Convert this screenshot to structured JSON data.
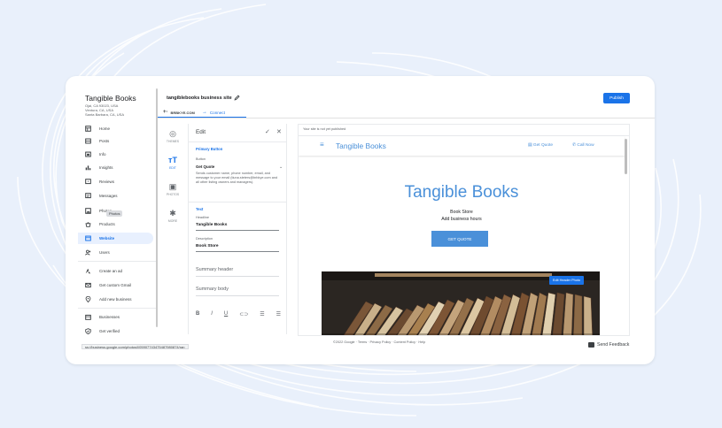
{
  "sidebar": {
    "business_name": "Tangible Books",
    "address_lines": [
      "Ojai, CA 93023, USA",
      "Ventura, CA, USA",
      "Santa Barbara, CA, USA"
    ],
    "items": [
      {
        "label": "Home",
        "icon": "home-icon"
      },
      {
        "label": "Posts",
        "icon": "posts-icon"
      },
      {
        "label": "Info",
        "icon": "info-icon"
      },
      {
        "label": "Insights",
        "icon": "insights-icon"
      },
      {
        "label": "Reviews",
        "icon": "reviews-icon"
      },
      {
        "label": "Messages",
        "icon": "messages-icon"
      },
      {
        "label": "Photos",
        "icon": "photos-icon"
      },
      {
        "label": "Products",
        "icon": "products-icon"
      },
      {
        "label": "Website",
        "icon": "website-icon",
        "active": true
      },
      {
        "label": "Users",
        "icon": "users-icon"
      },
      {
        "label": "Create an ad",
        "icon": "ads-icon"
      },
      {
        "label": "Get custom Gmail",
        "icon": "gmail-icon"
      },
      {
        "label": "Add new business",
        "icon": "add-location-icon"
      },
      {
        "label": "Businesses",
        "icon": "businesses-icon"
      },
      {
        "label": "Get verified",
        "icon": "verified-icon"
      }
    ],
    "tooltip": "Photos",
    "status_url": "ss://business.google.com/photos/l/05907743475487980874/ran"
  },
  "topbar": {
    "site_title": "tangiblebooks business site",
    "publish_label": "Publish",
    "domain": "BRBKYE.COM",
    "connect_label": "Connect"
  },
  "rail": {
    "items": [
      {
        "label": "THEMES",
        "icon": "palette-icon"
      },
      {
        "label": "EDIT",
        "icon": "text-format-icon",
        "active": true
      },
      {
        "label": "PHOTOS",
        "icon": "image-icon"
      },
      {
        "label": "MORE",
        "icon": "more-settings-icon"
      }
    ]
  },
  "edit_panel": {
    "title": "Edit",
    "primary_button_section": "Primary Button",
    "button_label": "Button",
    "button_value": "Get Quote",
    "button_description": "Sends customer name, phone number, email, and message to your email (tiuna.steters@brbkye.com and all other listing owners and managers).",
    "text_section": "Text",
    "headline_label": "Headline",
    "headline_value": "Tangible Books",
    "description_label": "Description",
    "description_value": "Book Store",
    "summary_header_placeholder": "Summary header",
    "summary_body_placeholder": "Summary body"
  },
  "preview": {
    "notice": "Your site is not yet published",
    "brand": "Tangible Books",
    "get_quote": "Get Quote",
    "call_now": "Call Now",
    "hero_title": "Tangible Books",
    "hero_subtitle": "Book Store",
    "hero_hours": "Add business hours",
    "cta_label": "GET QUOTE",
    "edit_photo_label": "Edit Header Photo",
    "accent": "#4a90d9"
  },
  "footer": {
    "links": "©2022 Google · Terms · Privacy Policy · Content Policy · Help",
    "feedback": "Send Feedback"
  }
}
